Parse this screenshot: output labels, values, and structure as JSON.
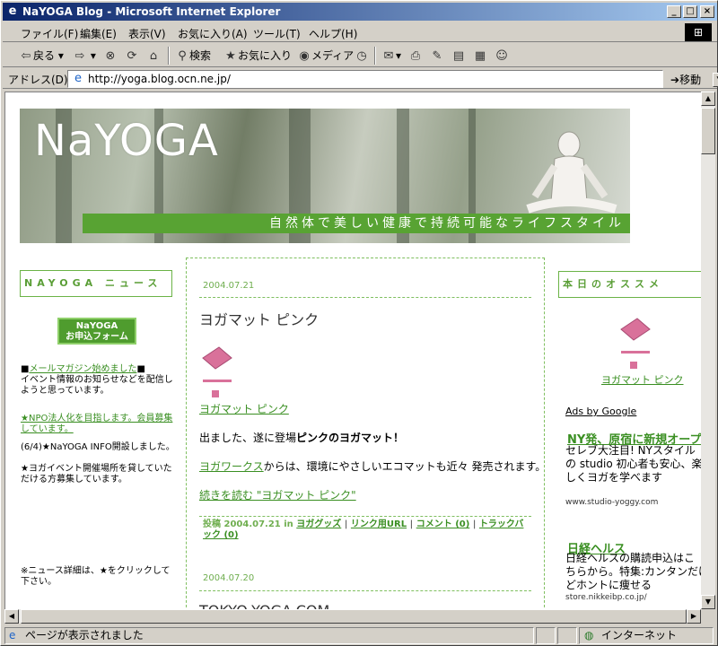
{
  "window": {
    "title": "NaYOGA Blog - Microsoft Internet Explorer",
    "icon": "ie-icon",
    "controls": [
      "_",
      "□",
      "×"
    ]
  },
  "menu": {
    "items": [
      "ファイル(F)",
      "編集(E)",
      "表示(V)",
      "お気に入り(A)",
      "ツール(T)",
      "ヘルプ(H)"
    ]
  },
  "toolbar": {
    "back": "戻る",
    "search": "検索",
    "favorites": "お気に入り",
    "media": "メディア"
  },
  "address": {
    "label": "アドレス(D)",
    "url": "http://yoga.blog.ocn.ne.jp/",
    "go": "移動"
  },
  "banner": {
    "title": "NaYOGA",
    "tagline": "自然体で美しい健康で持続可能なライフスタイル"
  },
  "left": {
    "news_heading": "NAYOGA ニュース",
    "form_button": [
      "NaYOGA",
      "お申込フォーム"
    ],
    "item1_link": "メールマガジン始めました",
    "item1_prefix": "■",
    "item1_suffix": "■",
    "item1_text": "イベント情報のお知らせなどを配信しようと思っています。",
    "item2_link": "★NPO法人化を目指します。会員募集しています。",
    "item3": "(6/4)★NaYOGA INFO開設しました。",
    "item4": "★ヨガイベント開催場所を貸していただける方募集しています。",
    "note": "※ニュース詳細は、★をクリックして下さい。"
  },
  "post1": {
    "date": "2004.07.21",
    "title": "ヨガマット ピンク",
    "image_link": "ヨガマット ピンク",
    "line1_pre": "出ました、遂に登場",
    "line1_bold": "ピンクのヨガマット！",
    "line2_link": "ヨガワークス",
    "line2_rest": "からは、環境にやさしいエコマットも近々 発売されます。",
    "more_link": "続きを読む \"ヨガマット ピンク\"",
    "footer_posted": "投稿",
    "footer_date": "2004.07.21",
    "footer_in": "in",
    "footer_category": "ヨガグッズ",
    "footer_permalink": "リンク用URL",
    "footer_comments": "コメント (0)",
    "footer_trackback": "トラックバック (0)",
    "footer_sep": "|"
  },
  "post2": {
    "date": "2004.07.20",
    "title": "TOKYO-YOGA.COM"
  },
  "right": {
    "heading": "本日のオススメ",
    "product_link": "ヨガマット ピンク",
    "ads_by": "Ads by Google",
    "ad1_title": "NY発、原宿に新規オープン",
    "ad1_text": [
      "セレブ大注目! NYスタイル",
      "の studio 初心者も安心、楽",
      "しくヨガを学べます"
    ],
    "ad1_url": "www.studio-yoggy.com",
    "ad2_title": "日経ヘルス",
    "ad2_text": [
      "日経ヘルスの購読申込はこ",
      "ちらから。特集:カンタンだけ",
      "どホントに痩せる"
    ],
    "ad2_url": "store.nikkeibp.co.jp/"
  },
  "status": {
    "text": "ページが表示されました",
    "zone": "インターネット"
  },
  "colors": {
    "accent_green": "#58a333",
    "link_green": "#3a8f22",
    "title_blue": "#0a246a",
    "mat_pink": "#d9719a"
  }
}
